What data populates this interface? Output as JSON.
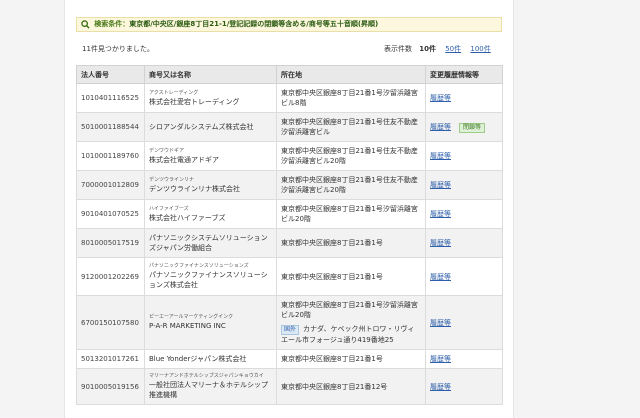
{
  "search": {
    "label": "検索条件：",
    "text": "東京都/中央区/銀座8丁目21-1/登記記録の閉鎖等含める/商号等五十音順(昇順)"
  },
  "results": {
    "count_text": "11件見つかりました。",
    "per_page_label": "表示件数",
    "per_page_current": "10件",
    "per_page_options": [
      "50件",
      "100件"
    ]
  },
  "table": {
    "headers": [
      "法人番号",
      "商号又は名称",
      "所在地",
      "変更履歴情報等"
    ],
    "rows": [
      {
        "number": "1010401116525",
        "kana": "アクストレーディング",
        "name": "株式会社愛宕トレーディング",
        "address": "東京都中央区銀座8丁目21番1号汐留浜離宮ビル8階",
        "history": "履歴等",
        "closed": "",
        "badge": "",
        "foreign": ""
      },
      {
        "number": "5010001188544",
        "kana": "",
        "name": "シロアンダルシステムズ株式会社",
        "address": "東京都中央区銀座8丁目21番1号住友不動産汐留浜離宮ビル",
        "history": "履歴等",
        "closed": "閉鎖等",
        "badge": "",
        "foreign": ""
      },
      {
        "number": "1010001189760",
        "kana": "デンワウドギア",
        "name": "株式会社電通アドギア",
        "address": "東京都中央区銀座8丁目21番1号住友不動産汐留浜離宮ビル20階",
        "history": "履歴等",
        "closed": "",
        "badge": "",
        "foreign": ""
      },
      {
        "number": "7000001012809",
        "kana": "デンツウラインリナ",
        "name": "デンツウラインリナ株式会社",
        "address": "東京都中央区銀座8丁目21番1号住友不動産汐留浜離宮ビル20階",
        "history": "履歴等",
        "closed": "",
        "badge": "",
        "foreign": ""
      },
      {
        "number": "9010401070525",
        "kana": "ハイファイブーズ",
        "name": "株式会社ハイファーブズ",
        "address": "東京都中央区銀座8丁目21番1号汐留浜離宮ビル20階",
        "history": "履歴等",
        "closed": "",
        "badge": "",
        "foreign": ""
      },
      {
        "number": "8010005017519",
        "kana": "",
        "name": "パナソニックシステムソリューションズジャパン労働組合",
        "address": "東京都中央区銀座8丁目21番1号",
        "history": "履歴等",
        "closed": "",
        "badge": "",
        "foreign": ""
      },
      {
        "number": "9120001202269",
        "kana": "パナソニックファイナンスソリューションズ",
        "name": "パナソニックファイナンスソリューションズ株式会社",
        "address": "東京都中央区銀座8丁目21番1号",
        "history": "履歴等",
        "closed": "",
        "badge": "",
        "foreign": ""
      },
      {
        "number": "6700150107580",
        "kana": "ピーエーアールマーケティングインク",
        "name": "P-A-R MARKETING INC",
        "address": "東京都中央区銀座8丁目21番1号汐留浜離宮ビル20階",
        "history": "履歴等",
        "closed": "",
        "badge": "国外",
        "foreign": "カナダ、ケベック州トロワ・リヴィエール市フォージュ通り419番地25"
      },
      {
        "number": "5013201017261",
        "kana": "",
        "name": "Blue Yonderジャパン株式会社",
        "address": "東京都中央区銀座8丁目21番1号",
        "history": "履歴等",
        "closed": "",
        "badge": "",
        "foreign": ""
      },
      {
        "number": "9010005019156",
        "kana": "マリーナアンドホテルシップスジャパンキョウカイ",
        "name": "一般社団法人マリーナ＆ホテルシップ推進機構",
        "address": "東京都中央区銀座8丁目21番12号",
        "history": "履歴等",
        "closed": "",
        "badge": "",
        "foreign": ""
      }
    ]
  }
}
